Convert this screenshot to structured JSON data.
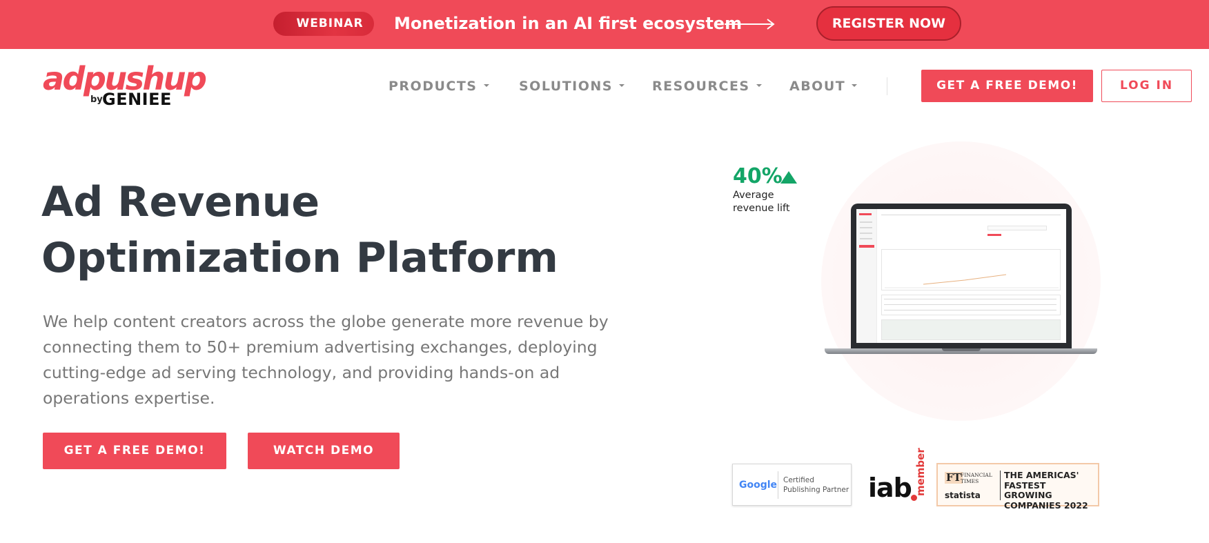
{
  "topbar": {
    "badge": "WEBINAR",
    "headline": "Monetization in an AI first ecosystem",
    "register": "REGISTER NOW"
  },
  "logo": {
    "main": "adpushup",
    "by": "by",
    "sub": "GENIEE"
  },
  "nav": {
    "items": [
      {
        "label": "PRODUCTS"
      },
      {
        "label": "SOLUTIONS"
      },
      {
        "label": "RESOURCES"
      },
      {
        "label": "ABOUT"
      }
    ],
    "demo": "GET A FREE DEMO!",
    "login": "LOG IN"
  },
  "hero": {
    "title_line1": "Ad Revenue",
    "title_line2": "Optimization Platform",
    "description": "We help content creators across the globe generate more revenue by connecting them to 50+ premium advertising exchanges, deploying cutting-edge ad serving technology, and providing hands-on ad operations expertise.",
    "cta_demo": "GET A FREE DEMO!",
    "cta_watch": "WATCH DEMO"
  },
  "stat": {
    "value": "40%",
    "label": "Average revenue lift"
  },
  "badges": {
    "google_word": "Google",
    "google_cert": "Certified Publishing Partner",
    "iab": "iab",
    "iab_member": "member",
    "ft_logo": "FT",
    "ft_name": "FINANCIAL TIMES",
    "statista": "statista",
    "ft_text": "THE AMERICAS' FASTEST GROWING COMPANIES 2022"
  },
  "colors": {
    "brand": "#f04a58",
    "green": "#13a567",
    "heading": "#333a42",
    "body_text": "#777777",
    "nav_text": "#8a8a8a"
  },
  "icons": [
    "arrow-right-icon",
    "caret-down-icon",
    "triangle-up-icon",
    "laptop-image"
  ]
}
